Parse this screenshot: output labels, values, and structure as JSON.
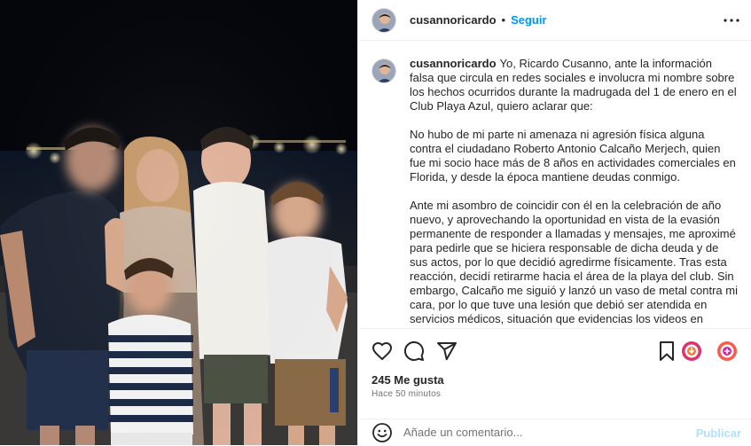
{
  "header": {
    "username": "cusannoricardo",
    "separator": "•",
    "follow_label": "Seguir",
    "avatar_icon": "profile-avatar",
    "more_icon": "more-options-icon"
  },
  "caption": {
    "username": "cusannoricardo",
    "paragraphs": [
      "Yo, Ricardo Cusanno, ante la información falsa que circula en redes sociales e involucra mi nombre sobre los hechos ocurridos durante la madrugada del 1 de enero en el Club Playa Azul, quiero aclarar que:",
      "No hubo de mi parte ni amenaza ni agresión física alguna contra el ciudadano Roberto Antonio Calcaño Merjech, quien fue mi socio hace más de 8 años en actividades comerciales en Florida, y desde la época mantiene deudas conmigo.",
      "Ante mi asombro de coincidir con él en la celebración de año nuevo, y aprovechando la oportunidad en vista de la evasión permanente de responder a llamadas y mensajes, me aproximé para pedirle que se hiciera responsable de dicha deuda y de sus actos, por lo que decidió agredirme físicamente. Tras esta reacción, decidí retirarme hacia el área de la playa del club. Sin embargo, Calcaño me siguió y lanzó un vaso de metal contra mi cara, por lo que tuve una lesión que debió ser atendida en servicios médicos, situación que evidencias los videos en manos"
    ]
  },
  "actions": {
    "icons": [
      "heart-icon",
      "comment-icon",
      "share-icon",
      "bookmark-icon",
      "fav-badge-icon",
      "gift-badge-icon"
    ]
  },
  "stats": {
    "likes": "245 Me gusta",
    "time": "Hace 50 minutos"
  },
  "comment_box": {
    "placeholder": "Añade un comentario...",
    "publish_label": "Publicar",
    "emoji_icon": "emoji-icon"
  },
  "colors": {
    "accent": "#0095f6",
    "publish_disabled": "#b2dffc",
    "muted": "#737373",
    "divider": "#efefef"
  }
}
